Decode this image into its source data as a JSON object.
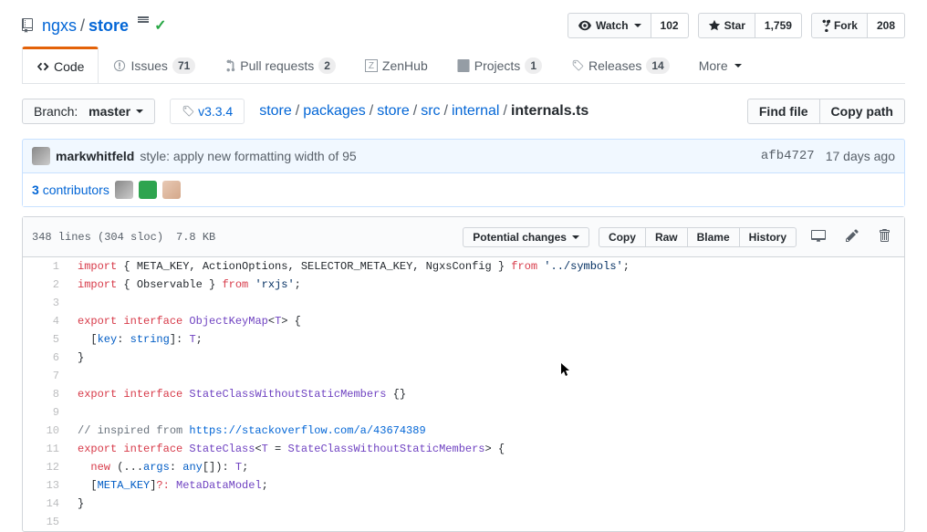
{
  "repo": {
    "owner": "ngxs",
    "name": "store"
  },
  "actions": {
    "watch": {
      "label": "Watch",
      "count": "102"
    },
    "star": {
      "label": "Star",
      "count": "1,759"
    },
    "fork": {
      "label": "Fork",
      "count": "208"
    }
  },
  "tabs": {
    "code": "Code",
    "issues": {
      "label": "Issues",
      "count": "71"
    },
    "pulls": {
      "label": "Pull requests",
      "count": "2"
    },
    "zenhub": "ZenHub",
    "projects": {
      "label": "Projects",
      "count": "1"
    },
    "releases": {
      "label": "Releases",
      "count": "14"
    },
    "more": "More"
  },
  "branch": {
    "label": "Branch:",
    "name": "master"
  },
  "tag": "v3.3.4",
  "breadcrumb": {
    "p0": "store",
    "p1": "packages",
    "p2": "store",
    "p3": "src",
    "p4": "internal",
    "file": "internals.ts"
  },
  "buttons": {
    "find": "Find file",
    "copy_path": "Copy path"
  },
  "commit": {
    "author": "markwhitfeld",
    "msg": "style: apply new formatting width of 95",
    "sha": "afb4727",
    "date": "17 days ago"
  },
  "contributors": {
    "count": "3",
    "label": "contributors"
  },
  "file": {
    "lines": "348 lines (304 sloc)",
    "size": "7.8 KB",
    "potential": "Potential changes",
    "copy": "Copy",
    "raw": "Raw",
    "blame": "Blame",
    "history": "History"
  },
  "code": {
    "l1a": "import",
    "l1b": " { META_KEY, ActionOptions, SELECTOR_META_KEY, NgxsConfig } ",
    "l1c": "from",
    "l1d": " '../symbols'",
    "l1e": ";",
    "l2a": "import",
    "l2b": " { Observable } ",
    "l2c": "from",
    "l2d": " 'rxjs'",
    "l2e": ";",
    "l4a": "export",
    "l4b": " interface",
    "l4c": " ObjectKeyMap",
    "l4d": "<",
    "l4e": "T",
    "l4f": "> {",
    "l5a": "  [",
    "l5b": "key",
    "l5c": ": ",
    "l5d": "string",
    "l5e": "]: ",
    "l5f": "T",
    "l5g": ";",
    "l6": "}",
    "l8a": "export",
    "l8b": " interface",
    "l8c": " StateClassWithoutStaticMembers",
    "l8d": " {}",
    "l10a": "// inspired from ",
    "l10b": "https://stackoverflow.com/a/43674389",
    "l11a": "export",
    "l11b": " interface",
    "l11c": " StateClass",
    "l11d": "<",
    "l11e": "T",
    "l11f": " = ",
    "l11g": "StateClassWithoutStaticMembers",
    "l11h": "> {",
    "l12a": "  new",
    "l12b": " (...",
    "l12c": "args",
    "l12d": ": ",
    "l12e": "any",
    "l12f": "[]): ",
    "l12g": "T",
    "l12h": ";",
    "l13a": "  [",
    "l13b": "META_KEY",
    "l13c": "]",
    "l13d": "?:",
    "l13e": " MetaDataModel",
    "l13f": ";",
    "l14": "}"
  }
}
